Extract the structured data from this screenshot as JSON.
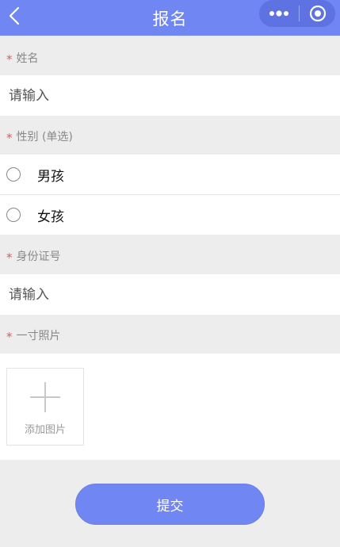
{
  "header": {
    "title": "报名",
    "back_icon": "chevron-left-icon",
    "more_icon": "more-dots-icon",
    "close_icon": "target-circle-icon",
    "bg_color": "#7086f3"
  },
  "form": {
    "name": {
      "required_mark": "*",
      "label": "姓名",
      "placeholder": "请输入",
      "value": ""
    },
    "gender": {
      "required_mark": "*",
      "label": "性别 (单选)",
      "options": [
        {
          "label": "男孩",
          "selected": false
        },
        {
          "label": "女孩",
          "selected": false
        }
      ]
    },
    "id_number": {
      "required_mark": "*",
      "label": "身份证号",
      "placeholder": "请输入",
      "value": ""
    },
    "photo": {
      "required_mark": "*",
      "label": "一寸照片",
      "add_label": "添加图片",
      "add_icon": "plus-icon"
    }
  },
  "submit": {
    "label": "提交"
  },
  "colors": {
    "accent": "#7086f3",
    "required": "#e05a5a",
    "background": "#ededed"
  }
}
